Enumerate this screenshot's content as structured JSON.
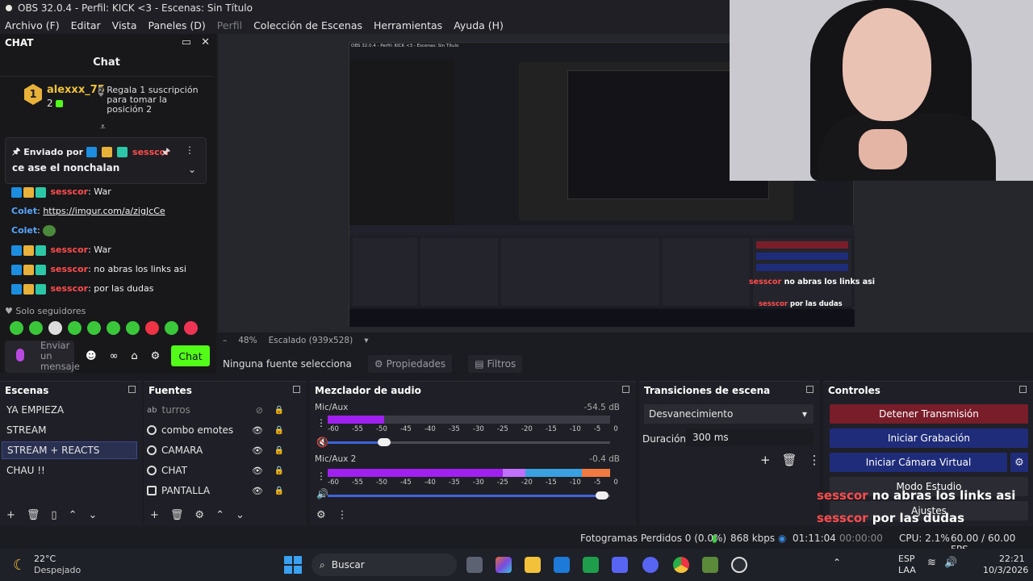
{
  "window": {
    "title": "OBS 32.0.4 - Perfil: KICK <3 - Escenas: Sin Título"
  },
  "menu": [
    "Archivo (F)",
    "Editar",
    "Vista",
    "Paneles (D)",
    "Perfil",
    "Colección de Escenas",
    "Herramientas",
    "Ayuda (H)"
  ],
  "chat": {
    "dock_title": "CHAT",
    "header": "Chat",
    "leader": {
      "rank": "1",
      "name": "alexxx_75",
      "count": "2"
    },
    "gift_rank": "2",
    "gift_text": "Regala 1 suscripción para tomar la posición 2",
    "pinned_by": "Enviado por",
    "pinned_user": "sesscor",
    "pinned_message": "ce ase el nonchalan",
    "messages": [
      {
        "user": "sesscor",
        "text": ": War"
      },
      {
        "user": "Colet",
        "text": "https://imgur.com/a/zigJcCe"
      },
      {
        "user": "Colet",
        "text": ""
      },
      {
        "user": "sesscor",
        "text": ": War"
      },
      {
        "user": "sesscor",
        "text": ": no abras los links asi"
      },
      {
        "user": "sesscor",
        "text": ": por las dudas"
      }
    ],
    "followers_label": "Solo seguidores",
    "input_placeholder": "Enviar un mensaje",
    "send_label": "Chat"
  },
  "preview": {
    "zoom": "48%",
    "scale": "Escalado (939x528)",
    "no_source": "Ninguna fuente selecciona",
    "properties_label": "Propiedades",
    "filters_label": "Filtros",
    "overlay_line1_user": "sesscor",
    "overlay_line1_text": "no abras los links asi",
    "overlay_line2_user": "sesscor",
    "overlay_line2_text": "por las dudas"
  },
  "scenes": {
    "title": "Escenas",
    "items": [
      "YA EMPIEZA",
      "STREAM",
      "STREAM + REACTS",
      "CHAU !!"
    ],
    "selected": "STREAM + REACTS"
  },
  "sources": {
    "title": "Fuentes",
    "items": [
      "turros",
      "combo emotes",
      "CAMARA",
      "CHAT",
      "PANTALLA"
    ]
  },
  "mixer": {
    "title": "Mezclador de audio",
    "channels": [
      {
        "name": "Mic/Aux",
        "db": "-54.5 dB",
        "level": 0.2,
        "muted": true
      },
      {
        "name": "Mic/Aux 2",
        "db": "-0.4 dB",
        "level": 0.97,
        "muted": false
      }
    ],
    "ticks": [
      "-60",
      "-55",
      "-50",
      "-45",
      "-40",
      "-35",
      "-30",
      "-25",
      "-20",
      "-15",
      "-10",
      "-5",
      "0"
    ]
  },
  "transitions": {
    "title": "Transiciones de escena",
    "current": "Desvanecimiento",
    "duration_label": "Duración",
    "duration_value": "300 ms"
  },
  "controls": {
    "title": "Controles",
    "stop_stream": "Detener Transmisión",
    "start_recording": "Iniciar Grabación",
    "start_vcam": "Iniciar Cámara Virtual",
    "studio_mode": "Modo Estudio",
    "settings": "Ajustes"
  },
  "status": {
    "dropped_frames": "Fotogramas Perdidos 0 (0.0%)",
    "kbps": "868 kbps",
    "stream_time": "01:11:04",
    "rec_time": "00:00:00",
    "cpu": "CPU: 2.1%",
    "fps": "60.00 / 60.00 FPS"
  },
  "taskbar": {
    "temp": "22°C",
    "weather": "Despejado",
    "search": "Buscar",
    "lang1": "ESP",
    "lang2": "LAA",
    "time": "22:21",
    "date": "10/3/2026",
    "discord_badge": "6"
  },
  "colors": {
    "kick_green": "#53fc18",
    "stop_red": "#7a1d2a",
    "blue_btn": "#1f2c7a",
    "meter_purple": "#a020f0"
  }
}
